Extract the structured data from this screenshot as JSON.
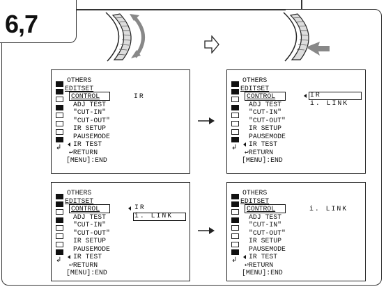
{
  "step_label": "6,7",
  "screens": [
    {
      "title": "OTHERS",
      "section": "EDITSET",
      "items": [
        "CONTROL",
        "ADJ TEST",
        "\"CUT-IN\"",
        "\"CUT-OUT\"",
        "IR SETUP",
        "PAUSEMODE",
        "IR TEST",
        "RETURN"
      ],
      "footer": "[MENU]:END",
      "options": [
        "IR"
      ]
    },
    {
      "title": "OTHERS",
      "section": "EDITSET",
      "items": [
        "CONTROL",
        "ADJ TEST",
        "\"CUT-IN\"",
        "\"CUT-OUT\"",
        "IR SETUP",
        "PAUSEMODE",
        "IR TEST",
        "RETURN"
      ],
      "footer": "[MENU]:END",
      "options": [
        "IR",
        "i. LINK"
      ]
    },
    {
      "title": "OTHERS",
      "section": "EDITSET",
      "items": [
        "CONTROL",
        "ADJ TEST",
        "\"CUT-IN\"",
        "\"CUT-OUT\"",
        "IR SETUP",
        "PAUSEMODE",
        "IR TEST",
        "RETURN"
      ],
      "footer": "[MENU]:END",
      "options": [
        "IR",
        "i. LINK"
      ]
    },
    {
      "title": "OTHERS",
      "section": "EDITSET",
      "items": [
        "CONTROL",
        "ADJ TEST",
        "\"CUT-IN\"",
        "\"CUT-OUT\"",
        "IR SETUP",
        "PAUSEMODE",
        "IR TEST",
        "RETURN"
      ],
      "footer": "[MENU]:END",
      "options": [
        "i. LINK"
      ]
    }
  ],
  "icons": [
    "tape-menu-icon",
    "tape-menu-icon",
    "camera-icon",
    "memory-icon",
    "video-icon",
    "settings-icon",
    "lcd-icon",
    "etc-icon",
    "return-icon"
  ]
}
